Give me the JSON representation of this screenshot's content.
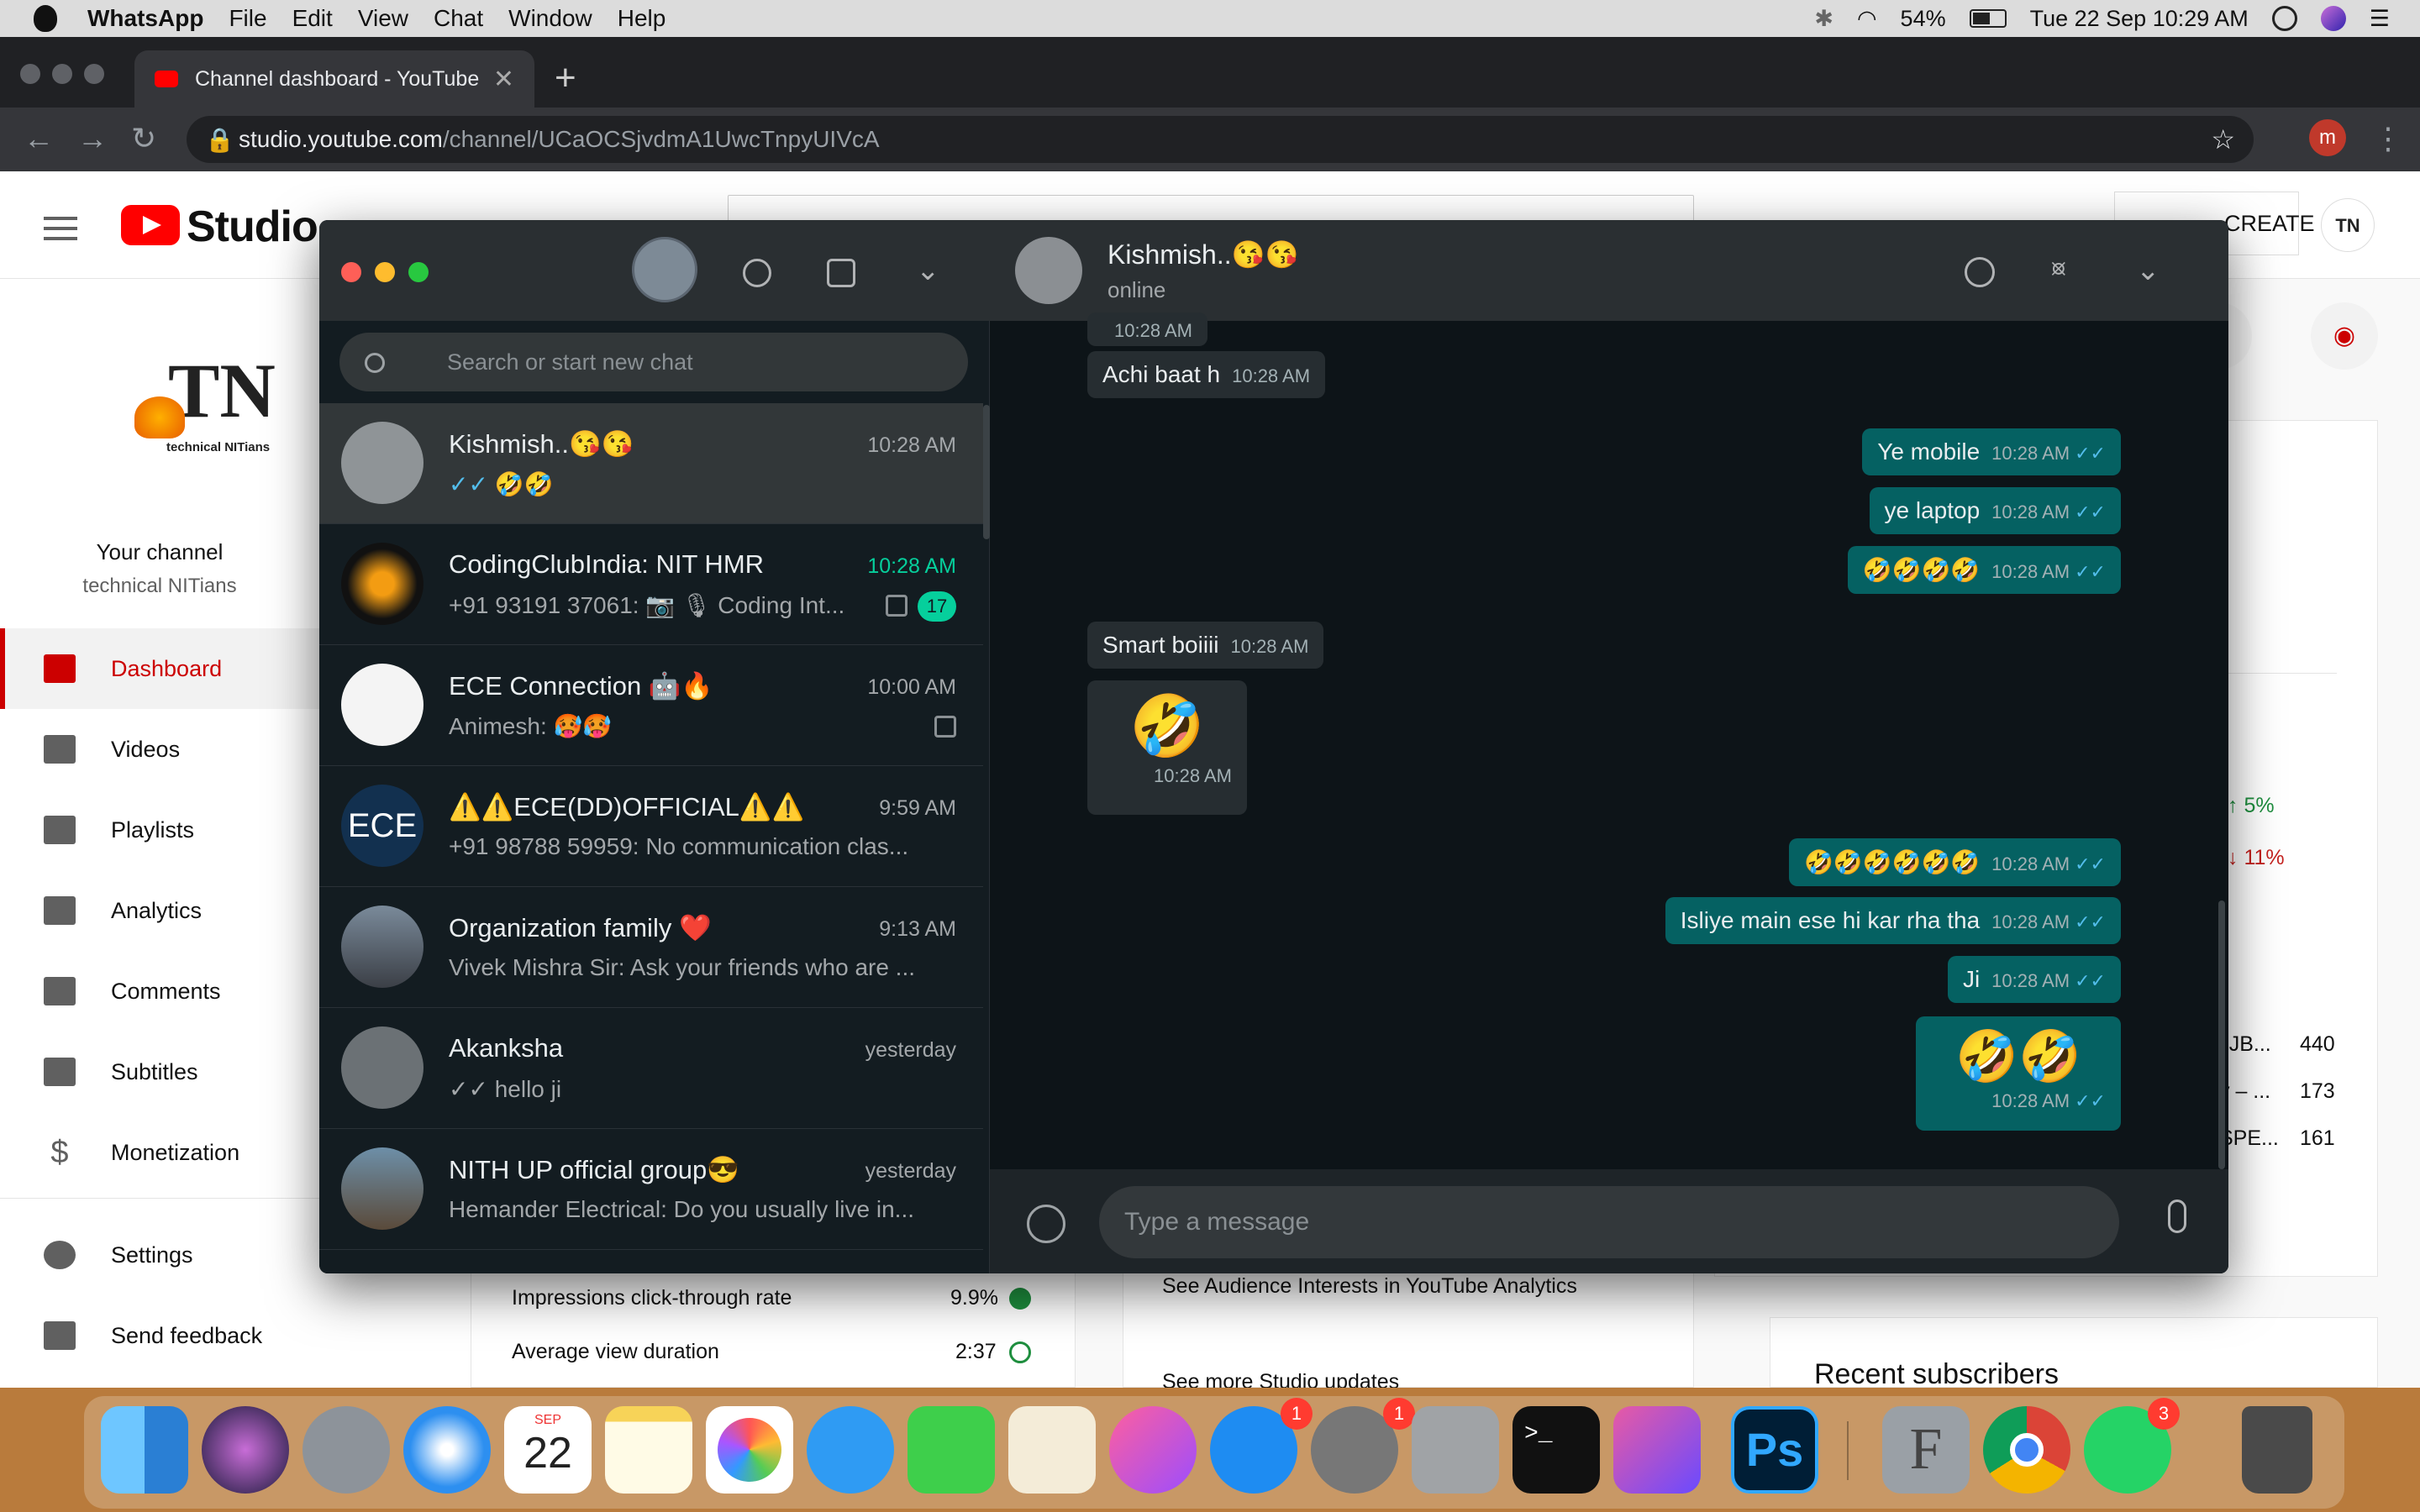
{
  "menubar": {
    "app": "WhatsApp",
    "items": [
      "File",
      "Edit",
      "View",
      "Chat",
      "Window",
      "Help"
    ],
    "battery": "54%",
    "datetime": "Tue 22 Sep  10:29 AM"
  },
  "browser": {
    "tab_title": "Channel dashboard - YouTube",
    "url_host": "studio.youtube.com",
    "url_path": "/channel/UCaOCSjvdmA1UwcTnpyUIVcA",
    "profile_initial": "m"
  },
  "studio": {
    "logo_text": "Studio",
    "create_label": "CREATE",
    "channel_label": "Your channel",
    "channel_name": "technical NITians",
    "nav": [
      "Dashboard",
      "Videos",
      "Playlists",
      "Analytics",
      "Comments",
      "Subtitles",
      "Monetization"
    ],
    "settings": "Settings",
    "feedback": "Send feedback",
    "impressions_label": "Impressions click-through rate",
    "impressions_value": "9.9%",
    "avg_view_label": "Average view duration",
    "avg_view_value": "2:37",
    "audience_link": "See Audience Interests in YouTube Analytics",
    "updates_link": "See more Studio updates",
    "recent_subs": "Recent subscribers",
    "pct_up": "5%",
    "pct_down": "11%",
    "top_values": [
      "440",
      "173",
      "161"
    ],
    "top_labels": [
      "' JB...",
      "y – ...",
      "SPE..."
    ]
  },
  "whatsapp": {
    "search_placeholder": "Search or start new chat",
    "chats": [
      {
        "name": "Kishmish..😘😘",
        "time": "10:28 AM",
        "preview": "✓✓ 🤣🤣"
      },
      {
        "name": "CodingClubIndia: NIT HMR",
        "time": "10:28 AM",
        "preview": "+91 93191 37061: 📷 🎙 Coding Int...",
        "count": "17"
      },
      {
        "name": "ECE Connection 🤖🔥",
        "time": "10:00 AM",
        "preview": "Animesh: 🥵🥵"
      },
      {
        "name": "⚠️⚠️ECE(DD)OFFICIAL⚠️⚠️",
        "time": "9:59 AM",
        "preview": "+91 98788 59959: No communication clas..."
      },
      {
        "name": "Organization family ❤️",
        "time": "9:13 AM",
        "preview": "Vivek Mishra Sir: Ask your friends who are ..."
      },
      {
        "name": "Akanksha",
        "time": "yesterday",
        "preview": "✓✓ hello ji"
      },
      {
        "name": "NITH UP official group😎",
        "time": "yesterday",
        "preview": "Hemander Electrical: Do you usually live in..."
      }
    ],
    "conversation": {
      "name": "Kishmish..😘😘",
      "status": "online",
      "messages": [
        {
          "dir": "in",
          "text": "",
          "time": "10:28 AM"
        },
        {
          "dir": "in",
          "text": "Achi baat h",
          "time": "10:28 AM"
        },
        {
          "dir": "out",
          "text": "Ye mobile",
          "time": "10:28 AM"
        },
        {
          "dir": "out",
          "text": "ye laptop",
          "time": "10:28 AM"
        },
        {
          "dir": "out",
          "text": "🤣🤣🤣🤣",
          "time": "10:28 AM"
        },
        {
          "dir": "in",
          "text": "Smart boiiii",
          "time": "10:28 AM"
        },
        {
          "dir": "in",
          "text": "🤣",
          "time": "10:28 AM"
        },
        {
          "dir": "out",
          "text": "🤣🤣🤣🤣🤣🤣",
          "time": "10:28 AM"
        },
        {
          "dir": "out",
          "text": "Isliye main ese hi kar rha tha",
          "time": "10:28 AM"
        },
        {
          "dir": "out",
          "text": "Ji",
          "time": "10:28 AM"
        },
        {
          "dir": "out",
          "text": "🤣🤣",
          "time": "10:28 AM"
        }
      ]
    },
    "composer_placeholder": "Type a message"
  },
  "dock": {
    "calendar_month": "SEP",
    "calendar_day": "22",
    "badges": {
      "appstore": "1",
      "prefs": "1",
      "whatsapp": "3"
    },
    "ps_label": "Ps",
    "f_label": "F"
  }
}
